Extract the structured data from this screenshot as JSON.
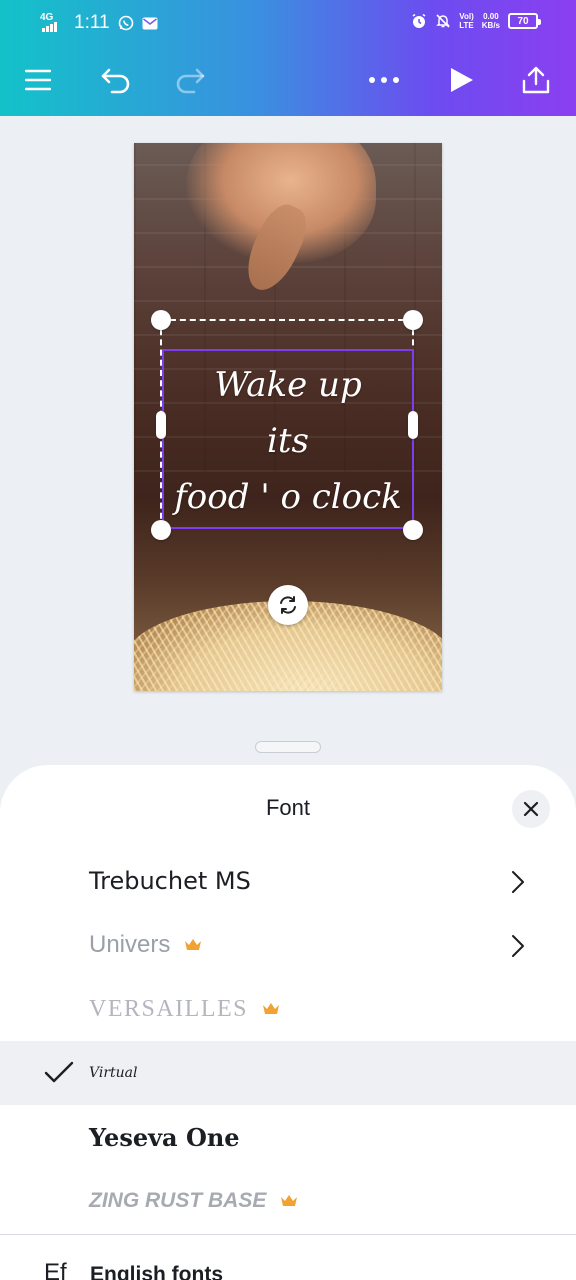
{
  "status_bar": {
    "network": "4G",
    "time": "1:11",
    "volte_top": "Vol)",
    "volte_bottom": "LTE",
    "speed_top": "0.00",
    "speed_bottom": "KB/s",
    "battery": "70"
  },
  "toolbar": {
    "icons": [
      "menu-icon",
      "undo-icon",
      "redo-icon",
      "more-icon",
      "play-icon",
      "share-icon"
    ]
  },
  "canvas": {
    "text_line1": "Wake up",
    "text_line2": "its",
    "text_line3": "food ' o clock"
  },
  "font_sheet": {
    "title": "Font",
    "fonts": [
      {
        "name": "Trebuchet MS",
        "premium": false,
        "has_submenu": true,
        "selected": false
      },
      {
        "name": "Univers",
        "premium": true,
        "has_submenu": true,
        "selected": false
      },
      {
        "name": "VERSAILLES",
        "premium": true,
        "has_submenu": false,
        "selected": false
      },
      {
        "name": "Virtual",
        "premium": false,
        "has_submenu": false,
        "selected": true
      },
      {
        "name": "Yeseva One",
        "premium": false,
        "has_submenu": false,
        "selected": false
      },
      {
        "name": "ZING RUST BASE",
        "premium": true,
        "has_submenu": false,
        "selected": false
      }
    ],
    "footer_icon": "Ef",
    "footer_label": "English fonts"
  },
  "colors": {
    "header_gradient_start": "#13c2c9",
    "header_gradient_end": "#8b3ff0",
    "selection_accent": "#7d3cf0",
    "crown": "#f0a330"
  }
}
